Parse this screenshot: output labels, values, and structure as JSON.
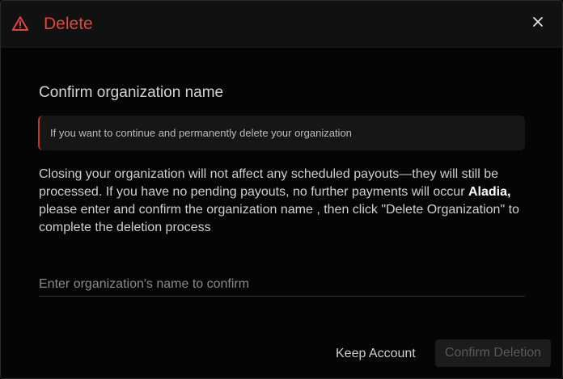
{
  "header": {
    "title": "Delete",
    "icon": "warning-triangle-icon",
    "close_icon": "close-icon",
    "title_color": "#e2453c"
  },
  "content": {
    "section_title": "Confirm organization name",
    "notice": "If you want to continue and permanently delete your organization",
    "body_before": "Closing your organization will not affect any scheduled payouts—they will still be processed. If you have no pending payouts, no further payments will occur ",
    "org_name": "Aladia,",
    "body_after": " please enter and confirm the organization name , then click \"Delete Organization\" to complete the deletion process"
  },
  "input": {
    "placeholder": "Enter organization's name to confirm",
    "value": ""
  },
  "actions": {
    "keep_label": "Keep Account",
    "confirm_label": "Confirm Deletion",
    "confirm_disabled": true
  }
}
